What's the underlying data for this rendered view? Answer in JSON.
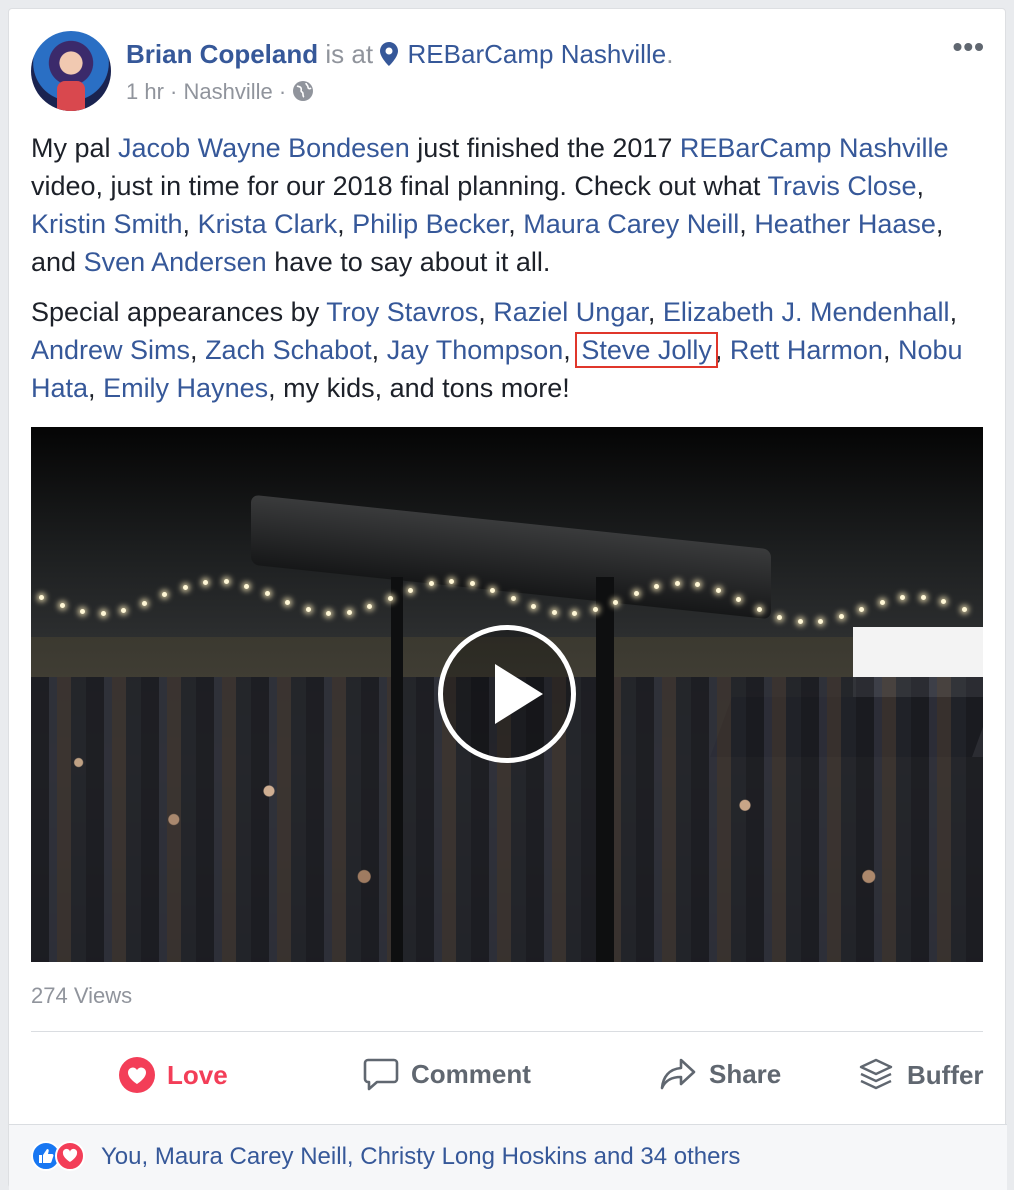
{
  "post": {
    "author": "Brian Copeland",
    "is_at": "is at",
    "location": "REBarCamp Nashville",
    "period": ".",
    "time": "1 hr",
    "sep1": "·",
    "city": "Nashville",
    "sep2": "·",
    "more_label": "•••",
    "privacy_icon": "globe-icon",
    "location_icon": "pin-icon"
  },
  "body": {
    "p1": [
      {
        "t": "My pal "
      },
      {
        "t": "Jacob Wayne Bondesen",
        "link": true
      },
      {
        "t": " just finished the 2017 "
      },
      {
        "t": "REBarCamp Nashville",
        "link": true
      },
      {
        "t": " video, just in time for our 2018 final planning. Check out what "
      },
      {
        "t": "Travis Close",
        "link": true
      },
      {
        "t": ", "
      },
      {
        "t": "Kristin Smith",
        "link": true
      },
      {
        "t": ", "
      },
      {
        "t": "Krista Clark",
        "link": true
      },
      {
        "t": ", "
      },
      {
        "t": "Philip Becker",
        "link": true
      },
      {
        "t": ", "
      },
      {
        "t": "Maura Carey Neill",
        "link": true
      },
      {
        "t": ", "
      },
      {
        "t": "Heather Haase",
        "link": true
      },
      {
        "t": ", and "
      },
      {
        "t": "Sven Andersen",
        "link": true
      },
      {
        "t": " have to say about it all."
      }
    ],
    "p2": [
      {
        "t": "Special appearances by "
      },
      {
        "t": "Troy Stavros",
        "link": true
      },
      {
        "t": ", "
      },
      {
        "t": "Raziel Ungar",
        "link": true
      },
      {
        "t": ", "
      },
      {
        "t": "Elizabeth J. Mendenhall",
        "link": true
      },
      {
        "t": ", "
      },
      {
        "t": "Andrew Sims",
        "link": true
      },
      {
        "t": ", "
      },
      {
        "t": "Zach Schabot",
        "link": true
      },
      {
        "t": ", "
      },
      {
        "t": "Jay Thompson",
        "link": true
      },
      {
        "t": ", "
      },
      {
        "t": "Steve Jolly",
        "link": true,
        "highlight": true
      },
      {
        "t": ", "
      },
      {
        "t": "Rett Harmon",
        "link": true
      },
      {
        "t": ", "
      },
      {
        "t": "Nobu Hata",
        "link": true
      },
      {
        "t": ", "
      },
      {
        "t": "Emily Haynes",
        "link": true
      },
      {
        "t": ", my kids, and tons more!"
      }
    ]
  },
  "video": {
    "play_icon": "play-icon"
  },
  "stats": {
    "views": "274 Views"
  },
  "actions": {
    "love": "Love",
    "comment": "Comment",
    "share": "Share",
    "buffer": "Buffer"
  },
  "reactions": {
    "summary": "You, Maura Carey Neill, Christy Long Hoskins and 34 others",
    "icons": [
      "like-icon",
      "love-icon"
    ]
  },
  "colors": {
    "link": "#365899",
    "muted": "#90949c",
    "love": "#f33e58",
    "highlight_box": "#e0362b"
  }
}
